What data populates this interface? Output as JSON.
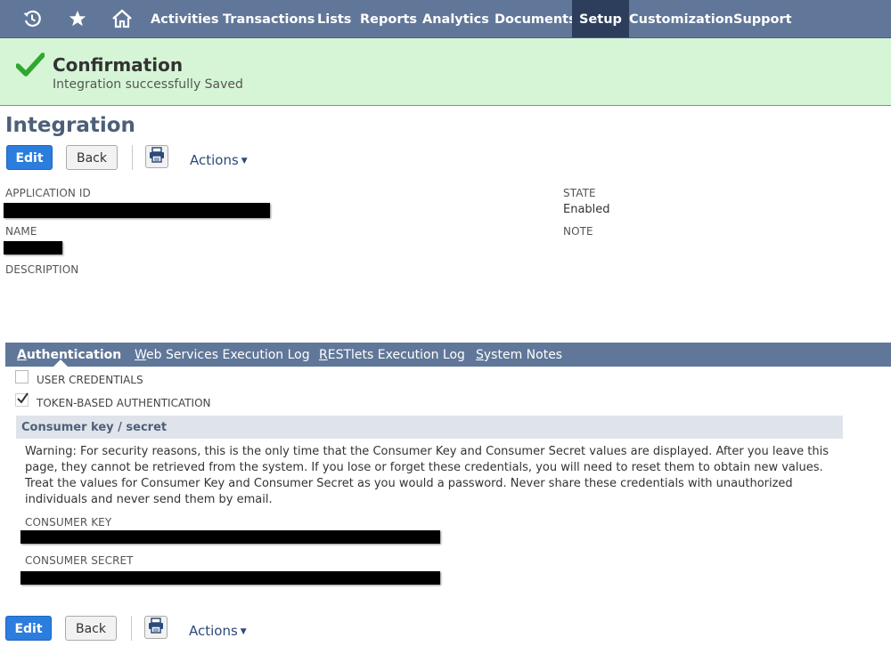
{
  "nav": {
    "items": [
      "Activities",
      "Transactions",
      "Lists",
      "Reports",
      "Analytics",
      "Documents",
      "Setup",
      "Customization",
      "Support"
    ],
    "active": "Setup",
    "icons": [
      "recent-records-icon",
      "star-icon",
      "home-icon"
    ]
  },
  "confirmation": {
    "title": "Confirmation",
    "message": "Integration successfully Saved"
  },
  "page": {
    "title": "Integration",
    "edit_label": "Edit",
    "back_label": "Back",
    "actions_label": "Actions"
  },
  "fields": {
    "application_id_label": "APPLICATION ID",
    "name_label": "NAME",
    "description_label": "DESCRIPTION",
    "state_label": "STATE",
    "state_value": "Enabled",
    "note_label": "NOTE"
  },
  "tabs": [
    {
      "first": "A",
      "rest": "uthentication",
      "active": true
    },
    {
      "first": "W",
      "rest": "eb Services Execution Log",
      "active": false
    },
    {
      "first": "R",
      "rest": "ESTlets Execution Log",
      "active": false
    },
    {
      "first": "S",
      "rest": "ystem Notes",
      "active": false
    }
  ],
  "auth": {
    "user_credentials_label": "USER CREDENTIALS",
    "user_credentials_checked": false,
    "tba_label": "TOKEN-BASED AUTHENTICATION",
    "tba_checked": true
  },
  "consumer": {
    "title": "Consumer key / secret",
    "warning_1": "Warning: For security reasons, this is the only time that the Consumer Key and Consumer Secret values are displayed. After you leave this page, they cannot be retrieved from the system. If you lose or forget these credentials, you will need to reset them to obtain new values.",
    "warning_2": "Treat the values for Consumer Key and Consumer Secret as you would a password. Never share these credentials with unauthorized individuals and never send them by email.",
    "key_label": "CONSUMER KEY",
    "secret_label": "CONSUMER SECRET"
  },
  "colors": {
    "nav_bg": "#607799",
    "nav_active": "#2c3e5c",
    "confirm_bg": "#d6f5d6",
    "check_green": "#2fa82f",
    "primary_button": "#2b7dde"
  }
}
